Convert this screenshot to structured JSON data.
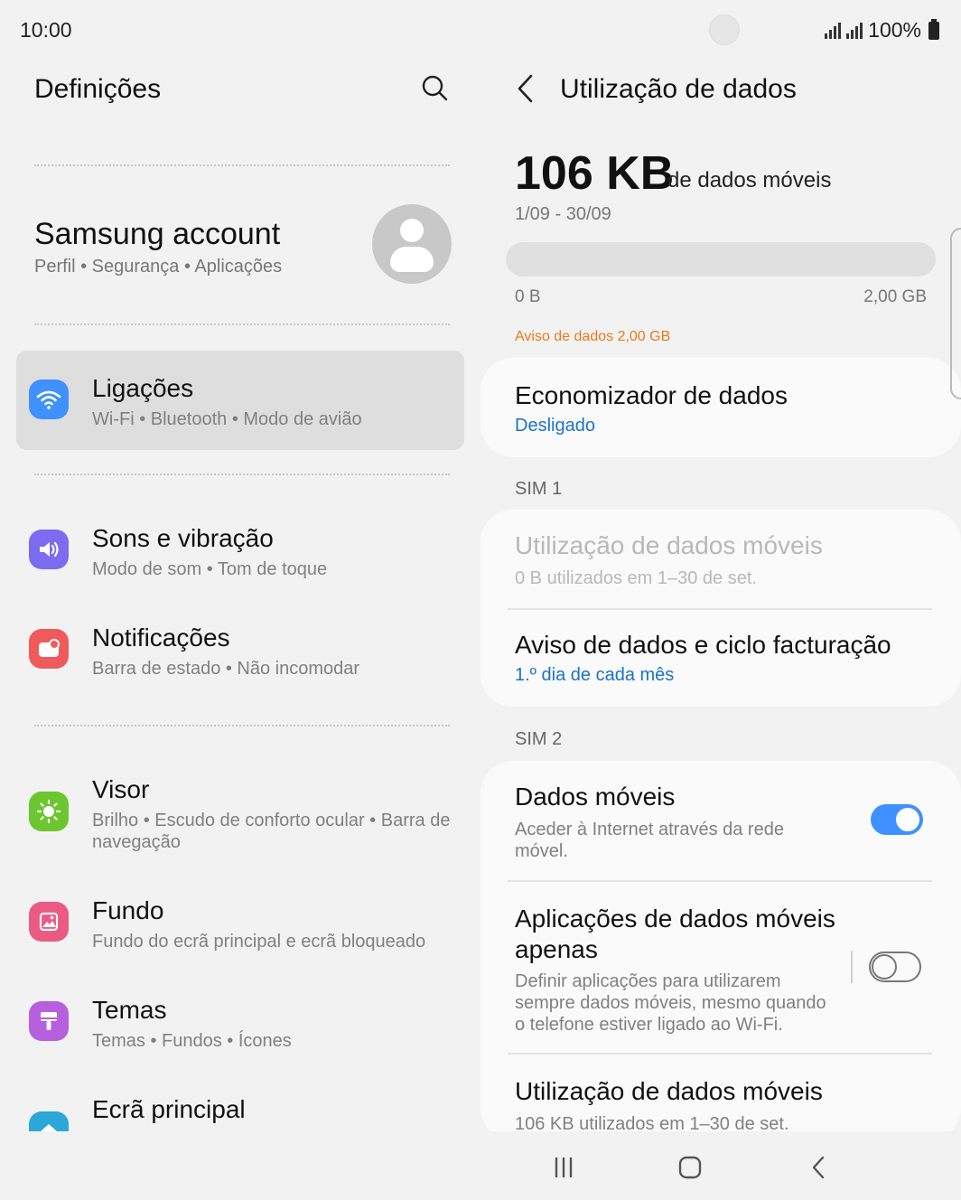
{
  "status": {
    "time": "10:00",
    "battery": "100%"
  },
  "left": {
    "title": "Definições",
    "account": {
      "name": "Samsung account",
      "sub": "Perfil  •  Segurança  •  Aplicações"
    },
    "items": [
      {
        "title": "Ligações",
        "sub": "Wi-Fi  •  Bluetooth  •  Modo de avião",
        "icon": "wifi-icon",
        "color": "#3e91ff"
      },
      {
        "title": "Sons e vibração",
        "sub": "Modo de som  •  Tom de toque",
        "icon": "speaker-icon",
        "color": "#7b6cf0"
      },
      {
        "title": "Notificações",
        "sub": "Barra de estado  •  Não incomodar",
        "icon": "notification-icon",
        "color": "#ef5a5a"
      },
      {
        "title": "Visor",
        "sub": "Brilho  •  Escudo de conforto ocular  •  Barra de navegação",
        "icon": "sun-icon",
        "color": "#6bc62f"
      },
      {
        "title": "Fundo",
        "sub": "Fundo do ecrã principal e ecrã bloqueado",
        "icon": "image-icon",
        "color": "#ea5a82"
      },
      {
        "title": "Temas",
        "sub": "Temas  •  Fundos  •  Ícones",
        "icon": "brush-icon",
        "color": "#b660e0"
      },
      {
        "title": "Ecrã principal",
        "sub": "",
        "icon": "home-icon",
        "color": "#2ba8d8"
      }
    ]
  },
  "right": {
    "title": "Utilização de dados",
    "usage": {
      "amount": "106 KB",
      "suffix": "de dados móveis",
      "period": "1/09 - 30/09",
      "min": "0 B",
      "max": "2,00 GB",
      "fraction": 5e-05
    },
    "warning": "Aviso de dados 2,00 GB",
    "saver": {
      "title": "Economizador de dados",
      "status": "Desligado"
    },
    "sim1": {
      "label": "SIM 1",
      "mobile_usage": {
        "title": "Utilização de dados móveis",
        "sub": "0 B utilizados em 1–30 de set."
      },
      "cycle": {
        "title": "Aviso de dados e ciclo facturação",
        "sub": "1.º dia de cada mês"
      }
    },
    "sim2": {
      "label": "SIM 2",
      "mobile_data": {
        "title": "Dados móveis",
        "sub": "Aceder à Internet através da rede móvel.",
        "enabled": true
      },
      "apps_only": {
        "title": "Aplicações de dados móveis apenas",
        "sub": "Definir aplicações para utilizarem sempre dados móveis, mesmo quando o telefone estiver ligado ao Wi-Fi.",
        "enabled": false
      },
      "mobile_usage": {
        "title": "Utilização de dados móveis",
        "sub": "106 KB utilizados em 1–30 de set."
      }
    }
  },
  "colors": {
    "accent": "#3e91ff",
    "link": "#1a73c8",
    "warning": "#e97a1a"
  }
}
